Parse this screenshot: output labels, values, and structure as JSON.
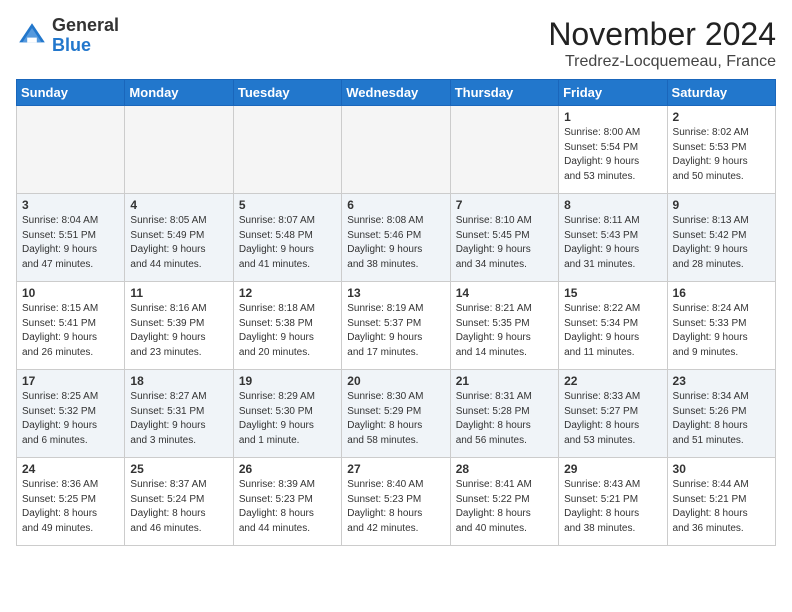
{
  "logo": {
    "general": "General",
    "blue": "Blue"
  },
  "title": "November 2024",
  "location": "Tredrez-Locquemeau, France",
  "weekdays": [
    "Sunday",
    "Monday",
    "Tuesday",
    "Wednesday",
    "Thursday",
    "Friday",
    "Saturday"
  ],
  "weeks": [
    [
      {
        "day": "",
        "info": ""
      },
      {
        "day": "",
        "info": ""
      },
      {
        "day": "",
        "info": ""
      },
      {
        "day": "",
        "info": ""
      },
      {
        "day": "",
        "info": ""
      },
      {
        "day": "1",
        "info": "Sunrise: 8:00 AM\nSunset: 5:54 PM\nDaylight: 9 hours\nand 53 minutes."
      },
      {
        "day": "2",
        "info": "Sunrise: 8:02 AM\nSunset: 5:53 PM\nDaylight: 9 hours\nand 50 minutes."
      }
    ],
    [
      {
        "day": "3",
        "info": "Sunrise: 8:04 AM\nSunset: 5:51 PM\nDaylight: 9 hours\nand 47 minutes."
      },
      {
        "day": "4",
        "info": "Sunrise: 8:05 AM\nSunset: 5:49 PM\nDaylight: 9 hours\nand 44 minutes."
      },
      {
        "day": "5",
        "info": "Sunrise: 8:07 AM\nSunset: 5:48 PM\nDaylight: 9 hours\nand 41 minutes."
      },
      {
        "day": "6",
        "info": "Sunrise: 8:08 AM\nSunset: 5:46 PM\nDaylight: 9 hours\nand 38 minutes."
      },
      {
        "day": "7",
        "info": "Sunrise: 8:10 AM\nSunset: 5:45 PM\nDaylight: 9 hours\nand 34 minutes."
      },
      {
        "day": "8",
        "info": "Sunrise: 8:11 AM\nSunset: 5:43 PM\nDaylight: 9 hours\nand 31 minutes."
      },
      {
        "day": "9",
        "info": "Sunrise: 8:13 AM\nSunset: 5:42 PM\nDaylight: 9 hours\nand 28 minutes."
      }
    ],
    [
      {
        "day": "10",
        "info": "Sunrise: 8:15 AM\nSunset: 5:41 PM\nDaylight: 9 hours\nand 26 minutes."
      },
      {
        "day": "11",
        "info": "Sunrise: 8:16 AM\nSunset: 5:39 PM\nDaylight: 9 hours\nand 23 minutes."
      },
      {
        "day": "12",
        "info": "Sunrise: 8:18 AM\nSunset: 5:38 PM\nDaylight: 9 hours\nand 20 minutes."
      },
      {
        "day": "13",
        "info": "Sunrise: 8:19 AM\nSunset: 5:37 PM\nDaylight: 9 hours\nand 17 minutes."
      },
      {
        "day": "14",
        "info": "Sunrise: 8:21 AM\nSunset: 5:35 PM\nDaylight: 9 hours\nand 14 minutes."
      },
      {
        "day": "15",
        "info": "Sunrise: 8:22 AM\nSunset: 5:34 PM\nDaylight: 9 hours\nand 11 minutes."
      },
      {
        "day": "16",
        "info": "Sunrise: 8:24 AM\nSunset: 5:33 PM\nDaylight: 9 hours\nand 9 minutes."
      }
    ],
    [
      {
        "day": "17",
        "info": "Sunrise: 8:25 AM\nSunset: 5:32 PM\nDaylight: 9 hours\nand 6 minutes."
      },
      {
        "day": "18",
        "info": "Sunrise: 8:27 AM\nSunset: 5:31 PM\nDaylight: 9 hours\nand 3 minutes."
      },
      {
        "day": "19",
        "info": "Sunrise: 8:29 AM\nSunset: 5:30 PM\nDaylight: 9 hours\nand 1 minute."
      },
      {
        "day": "20",
        "info": "Sunrise: 8:30 AM\nSunset: 5:29 PM\nDaylight: 8 hours\nand 58 minutes."
      },
      {
        "day": "21",
        "info": "Sunrise: 8:31 AM\nSunset: 5:28 PM\nDaylight: 8 hours\nand 56 minutes."
      },
      {
        "day": "22",
        "info": "Sunrise: 8:33 AM\nSunset: 5:27 PM\nDaylight: 8 hours\nand 53 minutes."
      },
      {
        "day": "23",
        "info": "Sunrise: 8:34 AM\nSunset: 5:26 PM\nDaylight: 8 hours\nand 51 minutes."
      }
    ],
    [
      {
        "day": "24",
        "info": "Sunrise: 8:36 AM\nSunset: 5:25 PM\nDaylight: 8 hours\nand 49 minutes."
      },
      {
        "day": "25",
        "info": "Sunrise: 8:37 AM\nSunset: 5:24 PM\nDaylight: 8 hours\nand 46 minutes."
      },
      {
        "day": "26",
        "info": "Sunrise: 8:39 AM\nSunset: 5:23 PM\nDaylight: 8 hours\nand 44 minutes."
      },
      {
        "day": "27",
        "info": "Sunrise: 8:40 AM\nSunset: 5:23 PM\nDaylight: 8 hours\nand 42 minutes."
      },
      {
        "day": "28",
        "info": "Sunrise: 8:41 AM\nSunset: 5:22 PM\nDaylight: 8 hours\nand 40 minutes."
      },
      {
        "day": "29",
        "info": "Sunrise: 8:43 AM\nSunset: 5:21 PM\nDaylight: 8 hours\nand 38 minutes."
      },
      {
        "day": "30",
        "info": "Sunrise: 8:44 AM\nSunset: 5:21 PM\nDaylight: 8 hours\nand 36 minutes."
      }
    ]
  ]
}
